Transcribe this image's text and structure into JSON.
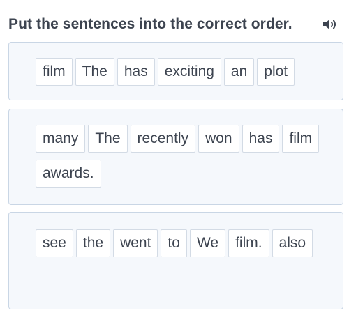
{
  "header": {
    "title": "Put the sentences into the correct order.",
    "speaker_icon": "speaker-sound-icon"
  },
  "colors": {
    "title_text": "#3d4450",
    "card_background": "#f5f8fc",
    "card_border": "#c9d6e5",
    "chip_background": "#ffffff",
    "chip_border": "#d3dbe5"
  },
  "sentences": [
    {
      "words": [
        "film",
        "The",
        "has",
        "exciting",
        "an",
        "plot"
      ]
    },
    {
      "words": [
        "many",
        "The",
        "recently",
        "won",
        "has",
        "film",
        "awards."
      ]
    },
    {
      "words": [
        "see",
        "the",
        "went",
        "to",
        "We",
        "film.",
        "also"
      ]
    }
  ]
}
